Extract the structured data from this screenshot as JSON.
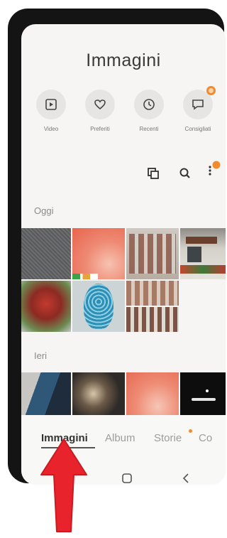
{
  "header": {
    "title": "Immagini"
  },
  "quick_actions": [
    {
      "label": "Video",
      "icon": "video-icon"
    },
    {
      "label": "Preferiti",
      "icon": "heart-icon"
    },
    {
      "label": "Recenti",
      "icon": "clock-icon"
    },
    {
      "label": "Consigliati",
      "icon": "suggestions-icon",
      "badge": true
    }
  ],
  "toolbar": {
    "icons": [
      "select-copy-icon",
      "search-icon",
      "more-menu-icon"
    ]
  },
  "sections": {
    "today": "Oggi",
    "yesterday": "Ieri"
  },
  "bottom_tabs": [
    {
      "label": "Immagini",
      "active": true
    },
    {
      "label": "Album"
    },
    {
      "label": "Storie",
      "badge": true
    },
    {
      "label": "Co"
    }
  ],
  "colors": {
    "accent": "#f28a2e",
    "annotation_arrow": "#e8232b",
    "screen_bg": "#f6f5f3"
  }
}
